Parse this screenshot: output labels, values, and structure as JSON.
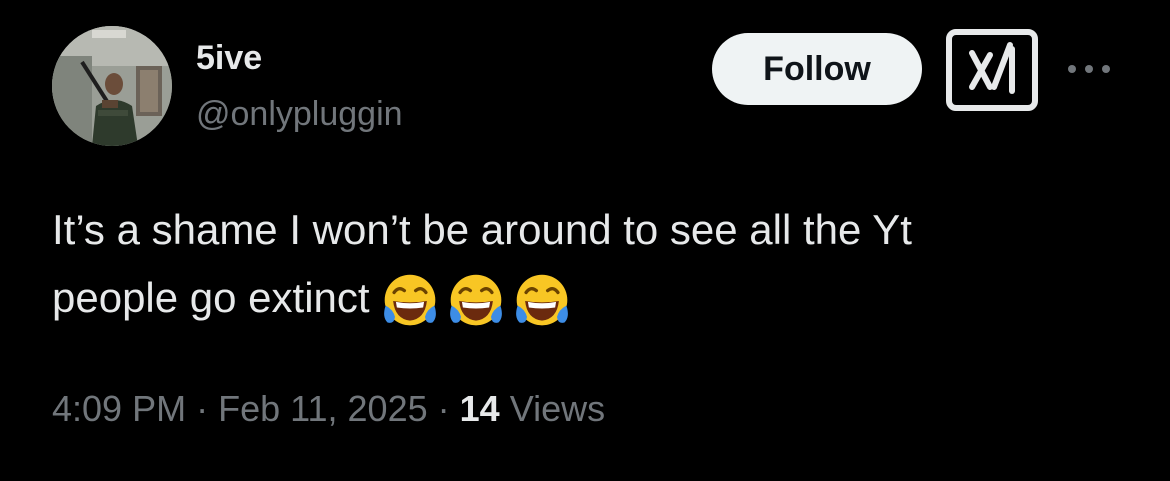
{
  "author": {
    "display_name": "5ive",
    "handle": "@onlypluggin",
    "avatar_icon": "profile-avatar"
  },
  "actions": {
    "follow_label": "Follow",
    "grok_icon": "grok-icon",
    "more_icon": "more-options-icon"
  },
  "tweet": {
    "text_line1": "It’s a shame I won’t be around to see all the Yt",
    "text_line2": "people go extinct",
    "emojis": [
      "tears-of-joy-emoji",
      "tears-of-joy-emoji",
      "tears-of-joy-emoji"
    ]
  },
  "meta": {
    "time": "4:09 PM",
    "separator": "·",
    "date": "Feb 11, 2025",
    "views_count": "14",
    "views_label": "Views"
  },
  "colors": {
    "background": "#000000",
    "primary_text": "#e7e9ea",
    "secondary_text": "#71767b",
    "follow_bg": "#eff3f4",
    "follow_text": "#0f1419"
  }
}
